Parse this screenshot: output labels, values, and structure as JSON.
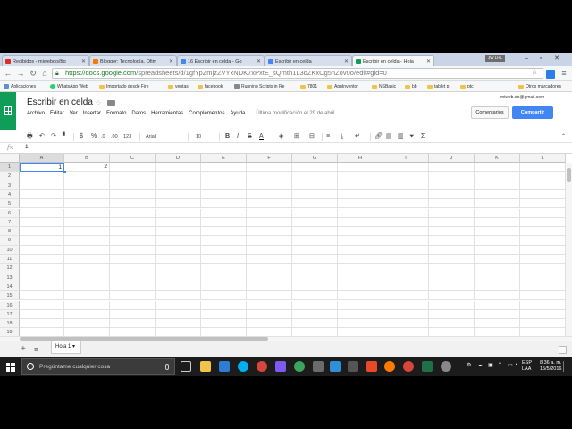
{
  "browser": {
    "tabs": [
      {
        "label": "Recibidos - miwebdo@g",
        "icon": "gmail-icon",
        "color": "#d93025"
      },
      {
        "label": "Blogger: Tecnología, Ofim",
        "icon": "blogger-icon",
        "color": "#f57c00"
      },
      {
        "label": "16 Escribir en celda - Go",
        "icon": "docs-icon",
        "color": "#4285f4"
      },
      {
        "label": "Escribir en celda",
        "icon": "page-icon",
        "color": "#4285f4"
      },
      {
        "label": "Escribir en celda - Hoja",
        "icon": "sheets-icon",
        "color": "#0f9d58",
        "active": true
      }
    ],
    "profile_label": "JW LHL",
    "url_host": "https://docs.google.com",
    "url_path": "/spreadsheets/d/1gfYpZmjzZVYxNDK7xPxtE_sQmth1L3oZKxCg5nZov0o/edit#gid=0",
    "bookmarks": [
      {
        "label": "Aplicaciones",
        "icon": "apps-icon"
      },
      {
        "label": "WhatsApp Web",
        "icon": "whatsapp-icon"
      },
      {
        "label": "Importado desde Fire",
        "icon": "folder-icon"
      },
      {
        "label": "ventas",
        "icon": "folder-icon"
      },
      {
        "label": "facebook",
        "icon": "folder-icon"
      },
      {
        "label": "Running Scripts in Re",
        "icon": "page-icon"
      },
      {
        "label": "7801",
        "icon": "folder-icon"
      },
      {
        "label": "AppInventor",
        "icon": "folder-icon"
      },
      {
        "label": "NSBasic",
        "icon": "folder-icon"
      },
      {
        "label": "bb",
        "icon": "folder-icon"
      },
      {
        "label": "tablet p",
        "icon": "folder-icon"
      },
      {
        "label": "ptc",
        "icon": "folder-icon"
      },
      {
        "label": "Otros marcadores",
        "icon": "folder-icon"
      }
    ]
  },
  "sheets": {
    "title": "Escribir en celda",
    "menu": [
      "Archivo",
      "Editar",
      "Ver",
      "Insertar",
      "Formato",
      "Datos",
      "Herramientas",
      "Complementos",
      "Ayuda"
    ],
    "last_edit": "Última modificación el 29 de abril",
    "user_email": "miweb.do@gmail.com",
    "comments_label": "Comentarios",
    "share_label": "Compartir",
    "toolbar": {
      "currency": "$",
      "percent": "%",
      "dec_less": ".0",
      "dec_more": ".00",
      "format": "123",
      "font": "Arial",
      "size": "10",
      "bold": "B",
      "italic": "I",
      "strike": "S",
      "textcolor": "A",
      "sum": "Σ"
    },
    "fx_label": "fx",
    "fx_value": "1",
    "columns": [
      "A",
      "B",
      "C",
      "D",
      "E",
      "F",
      "G",
      "H",
      "I",
      "J",
      "K",
      "L"
    ],
    "rows": [
      "1",
      "2",
      "3",
      "4",
      "5",
      "6",
      "7",
      "8",
      "9",
      "10",
      "11",
      "12",
      "13",
      "14",
      "15",
      "16",
      "17",
      "18",
      "19"
    ],
    "cells": {
      "A1": "1",
      "B1": "2"
    },
    "sheet_tab": "Hoja 1"
  },
  "taskbar": {
    "search_placeholder": "Pregúntame cualquier cosa",
    "lang1": "ESP",
    "lang2": "LAA",
    "time": "8:36 a. m.",
    "date": "15/5/2016"
  }
}
